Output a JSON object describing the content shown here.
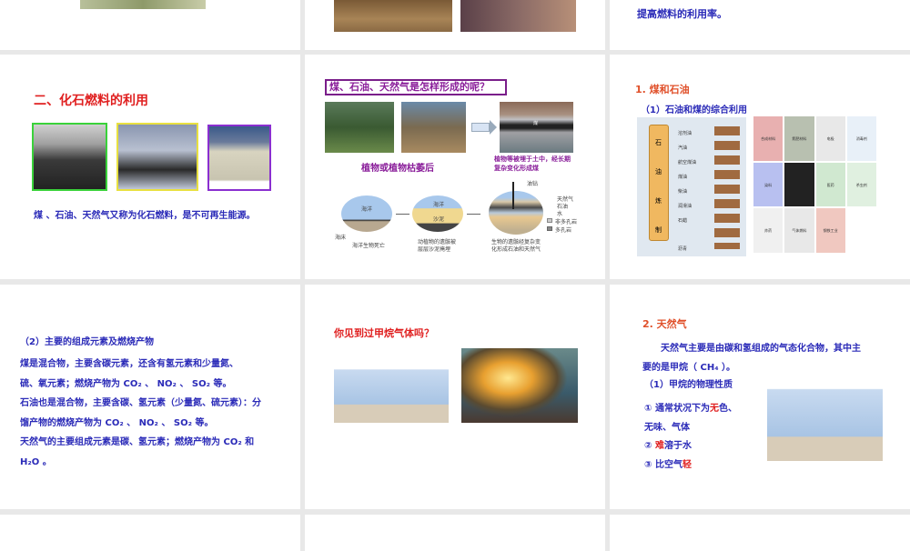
{
  "slides": {
    "s3": {
      "text_last_line": "提高燃料的利用率。"
    },
    "s4": {
      "title": "二、化石燃料的利用",
      "caption": "煤 、石油、天然气又称为化石燃料，是不可再生能源。"
    },
    "s5": {
      "title": "煤、石油、天然气是怎样形成的呢？",
      "caption_left": "植物或植物枯萎后",
      "caption_right_1": "植物等被埋于土中，经长期",
      "caption_right_2": "复杂变化形成煤",
      "coal_label": "煤",
      "diagram": {
        "ocean": "海洋",
        "seabed": "海床",
        "sand": "沙泥",
        "rig": "油钻",
        "gas": "天然气",
        "oil": "石油",
        "water": "水",
        "nonporous": "非多孔岩",
        "porous": "多孔岩",
        "step1": "海洋生物死亡",
        "step2a": "动植物的遗骸被",
        "step2b": "层层沙泥掩埋",
        "step3a": "生物的遗骸经复杂变",
        "step3b": "化形成石油和天然气"
      }
    },
    "s6": {
      "title": "1. 煤和石油",
      "subtitle": "（1）石油和煤的综合利用",
      "column_chars": [
        "石",
        "油",
        "炼",
        "制"
      ],
      "products": [
        "溶剂油",
        "汽油",
        "航空煤油",
        "煤油",
        "柴油",
        "润滑油",
        "石蜡",
        "沥青"
      ],
      "coal_uses": [
        "合成材料",
        "氮肥材料",
        "电极",
        "消毒剂",
        "染料",
        "医药",
        "杀虫剂",
        "炸药",
        "气体燃料",
        "钢铁工业"
      ]
    },
    "s7": {
      "heading": "（2）主要的组成元素及燃烧产物",
      "lines": [
        "煤是混合物，主要含碳元素，还含有氢元素和少量氮、",
        "硫、氧元素；燃烧产物为 CO₂ 、 NO₂ 、 SO₂ 等。",
        "石油也是混合物，主要含碳、氢元素（少量氮、硫元素）：分",
        "馏产物的燃烧产物为 CO₂ 、 NO₂ 、 SO₂ 等。",
        "天然气的主要组成元素是碳、氢元素；燃烧产物为 CO₂ 和",
        "H₂O 。"
      ]
    },
    "s8": {
      "title": "你见到过甲烷气体吗？"
    },
    "s9": {
      "title": "2. 天然气",
      "para_1": "天然气主要是由碳和氢组成的气态化合物，其中主",
      "para_2": "要的是甲烷（ CH₄ ）。",
      "subheading": "（1）甲烷的物理性质",
      "p1_pre": "① 通常状况下为",
      "p1_red": "无",
      "p1_post": "色、",
      "p1_line2": "无味、气体",
      "p2_pre": "② ",
      "p2_red": "难",
      "p2_post": "溶于水",
      "p3_pre": "③ 比空气",
      "p3_red": "轻"
    }
  }
}
